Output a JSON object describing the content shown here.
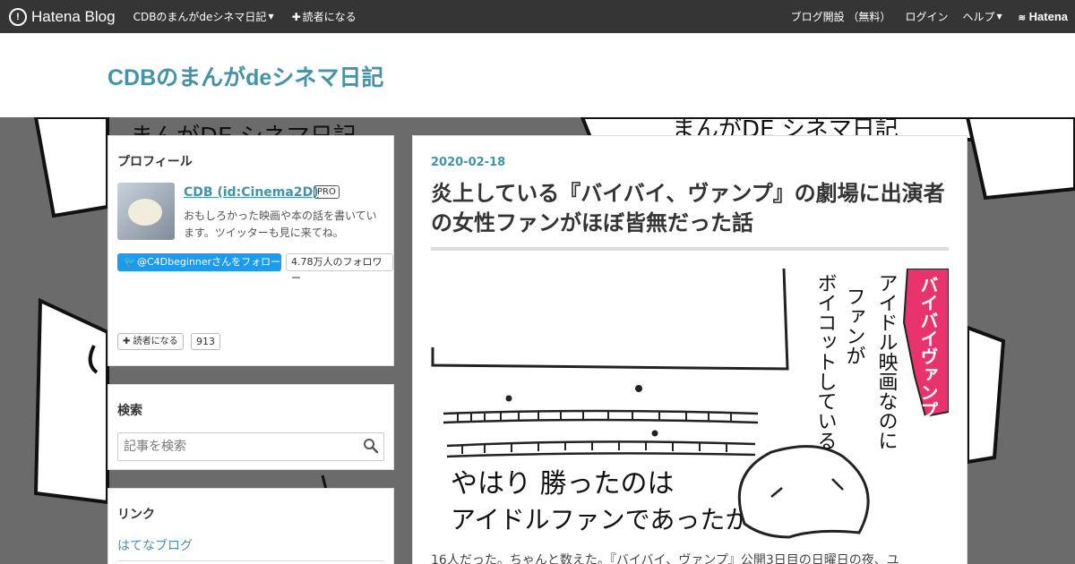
{
  "topbar": {
    "logo": "Hatena Blog",
    "blog_menu": "CDBのまんがdeシネマ日記",
    "subscribe": "読者になる",
    "open_blog": "ブログ開設 （無料）",
    "login": "ログイン",
    "help": "ヘルプ",
    "hatena": "Hatena"
  },
  "header": {
    "title": "CDBのまんがdeシネマ日記"
  },
  "background": {
    "banner_text": "まんがDE シネマ日記"
  },
  "profile": {
    "heading": "プロフィール",
    "name": "CDB (id:Cinema2D)",
    "badge": "PRO",
    "description": "おもしろかった映画や本の話を書いています。ツイッターも見に来てね。",
    "twitter_follow": "@C4Dbeginnerさんをフォロー",
    "follower_count": "4.78万人のフォロワー",
    "subscribe_label": "読者になる",
    "subscribe_count": "913"
  },
  "search": {
    "heading": "検索",
    "placeholder": "記事を検索"
  },
  "links": {
    "heading": "リンク",
    "items": [
      "はてなブログ"
    ]
  },
  "article": {
    "date": "2020-02-18",
    "title": "炎上している『バイバイ、ヴァンプ』の劇場に出演者の女性ファンがほぼ皆無だった話",
    "comic": {
      "sign_label": "バイバイヴァンプ",
      "vertical_line1": "アイドル映画なのに",
      "vertical_line2": "ファンが",
      "vertical_line3": "ボイコットしている",
      "caption_line1": "やはり 勝ったのは",
      "caption_line2": "アイドルファンであったか"
    },
    "body_start": "16人だった。ちゃんと数えた。『バイバイ、ヴァンプ』公開3日目の日曜日の夜、ユ"
  },
  "colors": {
    "accent": "#4394aa",
    "topbar": "#353535",
    "twitter": "#1d9bf0",
    "sign": "#e8336d"
  }
}
